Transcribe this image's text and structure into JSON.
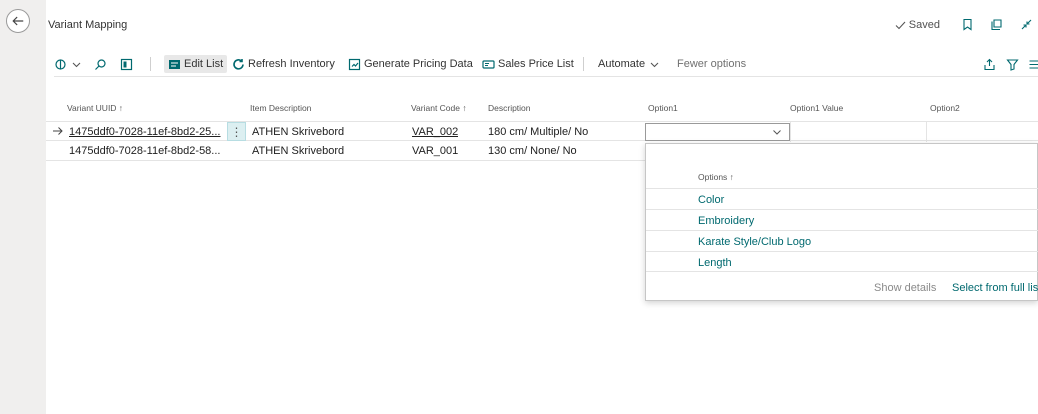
{
  "page": {
    "title": "Variant Mapping",
    "saved_label": "Saved"
  },
  "action_bar": {
    "edit_list": "Edit List",
    "refresh_inventory": "Refresh Inventory",
    "generate_pricing": "Generate Pricing Data",
    "sales_price_list": "Sales Price List",
    "automate": "Automate",
    "fewer_options": "Fewer options"
  },
  "grid": {
    "columns": [
      "Variant UUID ↑",
      "Item Description",
      "Variant Code ↑",
      "Description",
      "Option1",
      "Option1 Value",
      "Option2"
    ],
    "rows": [
      [
        "1475ddf0-7028-11ef-8bd2-25...",
        "ATHEN Skrivebord",
        "VAR_002",
        "180 cm/ Multiple/ No",
        "",
        "",
        ""
      ],
      [
        "1475ddf0-7028-11ef-8bd2-58...",
        "ATHEN Skrivebord",
        "VAR_001",
        "130 cm/ None/ No",
        "",
        "",
        ""
      ]
    ]
  },
  "lookup": {
    "header": "Options ↑",
    "items": [
      "Color",
      "Embroidery",
      "Karate Style/Club Logo",
      "Length"
    ],
    "show_details": "Show details",
    "select_full_list": "Select from full list"
  },
  "colors": {
    "accent": "#00696f",
    "selected_cell": "#dceff1",
    "background": "#f0efee"
  }
}
